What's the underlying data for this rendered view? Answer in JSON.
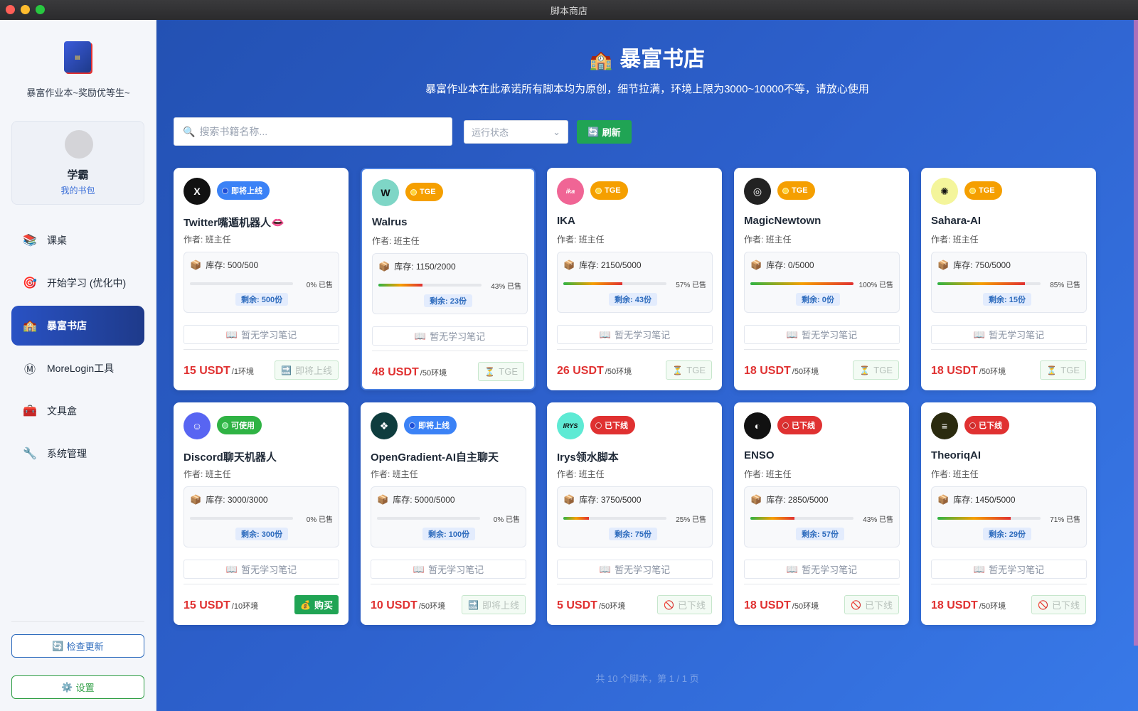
{
  "window": {
    "title": "脚本商店"
  },
  "sidebar": {
    "brand": "暴富作业本~奖励优等生~",
    "user": {
      "name": "学霸",
      "link": "我的书包"
    },
    "nav": [
      {
        "label": "课桌",
        "icon": "books-icon"
      },
      {
        "label": "开始学习 (优化中)",
        "icon": "target-icon"
      },
      {
        "label": "暴富书店",
        "icon": "school-icon",
        "active": true
      },
      {
        "label": "MoreLogin工具",
        "icon": "morelogin-m-icon"
      },
      {
        "label": "文具盒",
        "icon": "toolbox-icon"
      },
      {
        "label": "系统管理",
        "icon": "wrench-icon"
      }
    ],
    "update_label": "检查更新",
    "settings_label": "设置"
  },
  "header": {
    "title": "暴富书店",
    "subtitle": "暴富作业本在此承诺所有脚本均为原创，细节拉满，环境上限为3000~10000不等，请放心使用"
  },
  "toolbar": {
    "search_placeholder": "搜索书籍名称...",
    "status_placeholder": "运行状态",
    "refresh_label": "刷新"
  },
  "common": {
    "author": "作者: 班主任",
    "notes": "暂无学习笔记"
  },
  "colors": {
    "accent_blue": "#2351b3",
    "price_red": "#e03131",
    "buy_green": "#20a454"
  },
  "cards": [
    {
      "name": "Twitter嘴遁机器人👄",
      "logo": "X",
      "logo_bg": "#111111",
      "badge": "即将上线",
      "badge_type": "soon",
      "stock": "库存: 500/500",
      "sold_pct": 0,
      "sold": "0% 已售",
      "remain": "剩余: 500份",
      "price": "15 USDT",
      "unit": "/1环境",
      "action": "即将上线",
      "action_icon": "soon-icon"
    },
    {
      "name": "Walrus",
      "logo": "W",
      "logo_bg": "#7ed6c6",
      "badge": "TGE",
      "badge_type": "tge",
      "stock": "库存: 1150/2000",
      "sold_pct": 43,
      "sold": "43% 已售",
      "remain": "剩余: 23份",
      "price": "48 USDT",
      "unit": "/50环境",
      "action": "TGE",
      "action_icon": "hourglass-icon",
      "highlight": true
    },
    {
      "name": "IKA",
      "logo": "ika",
      "logo_bg": "#f06595",
      "badge": "TGE",
      "badge_type": "tge",
      "stock": "库存: 2150/5000",
      "sold_pct": 57,
      "sold": "57% 已售",
      "remain": "剩余: 43份",
      "price": "26 USDT",
      "unit": "/50环境",
      "action": "TGE",
      "action_icon": "hourglass-icon"
    },
    {
      "name": "MagicNewtown",
      "logo": "◎",
      "logo_bg": "#222222",
      "badge": "TGE",
      "badge_type": "tge",
      "stock": "库存: 0/5000",
      "sold_pct": 100,
      "sold": "100% 已售",
      "remain": "剩余: 0份",
      "price": "18 USDT",
      "unit": "/50环境",
      "action": "TGE",
      "action_icon": "hourglass-icon"
    },
    {
      "name": "Sahara-AI",
      "logo": "✺",
      "logo_bg": "#f4f59b",
      "badge": "TGE",
      "badge_type": "tge",
      "stock": "库存: 750/5000",
      "sold_pct": 85,
      "sold": "85% 已售",
      "remain": "剩余: 15份",
      "price": "18 USDT",
      "unit": "/50环境",
      "action": "TGE",
      "action_icon": "hourglass-icon"
    },
    {
      "name": "Discord聊天机器人",
      "logo": "☺",
      "logo_bg": "#5865f2",
      "badge": "可使用",
      "badge_type": "ok",
      "stock": "库存: 3000/3000",
      "sold_pct": 0,
      "sold": "0% 已售",
      "remain": "剩余: 300份",
      "price": "15 USDT",
      "unit": "/10环境",
      "action": "购买",
      "action_icon": "money-bag-icon",
      "buy": true
    },
    {
      "name": "OpenGradient-AI自主聊天",
      "logo": "❖",
      "logo_bg": "#0f3d3e",
      "badge": "即将上线",
      "badge_type": "soon",
      "stock": "库存: 5000/5000",
      "sold_pct": 0,
      "sold": "0% 已售",
      "remain": "剩余: 100份",
      "price": "10 USDT",
      "unit": "/50环境",
      "action": "即将上线",
      "action_icon": "soon-icon"
    },
    {
      "name": "Irys领水脚本",
      "logo": "IRYS",
      "logo_bg": "#5eead4",
      "badge": "已下线",
      "badge_type": "off",
      "stock": "库存: 3750/5000",
      "sold_pct": 25,
      "sold": "25% 已售",
      "remain": "剩余: 75份",
      "price": "5 USDT",
      "unit": "/50环境",
      "action": "已下线",
      "action_icon": "prohibited-icon"
    },
    {
      "name": "ENSO",
      "logo": "◐",
      "logo_bg": "#111111",
      "badge": "已下线",
      "badge_type": "off",
      "stock": "库存: 2850/5000",
      "sold_pct": 43,
      "sold": "43% 已售",
      "remain": "剩余: 57份",
      "price": "18 USDT",
      "unit": "/50环境",
      "action": "已下线",
      "action_icon": "prohibited-icon"
    },
    {
      "name": "TheoriqAI",
      "logo": "≡",
      "logo_bg": "#2b2b0f",
      "badge": "已下线",
      "badge_type": "off",
      "stock": "库存: 1450/5000",
      "sold_pct": 71,
      "sold": "71% 已售",
      "remain": "剩余: 29份",
      "price": "18 USDT",
      "unit": "/50环境",
      "action": "已下线",
      "action_icon": "prohibited-icon"
    }
  ],
  "pagination": "共 10 个脚本，第 1 / 1 页"
}
